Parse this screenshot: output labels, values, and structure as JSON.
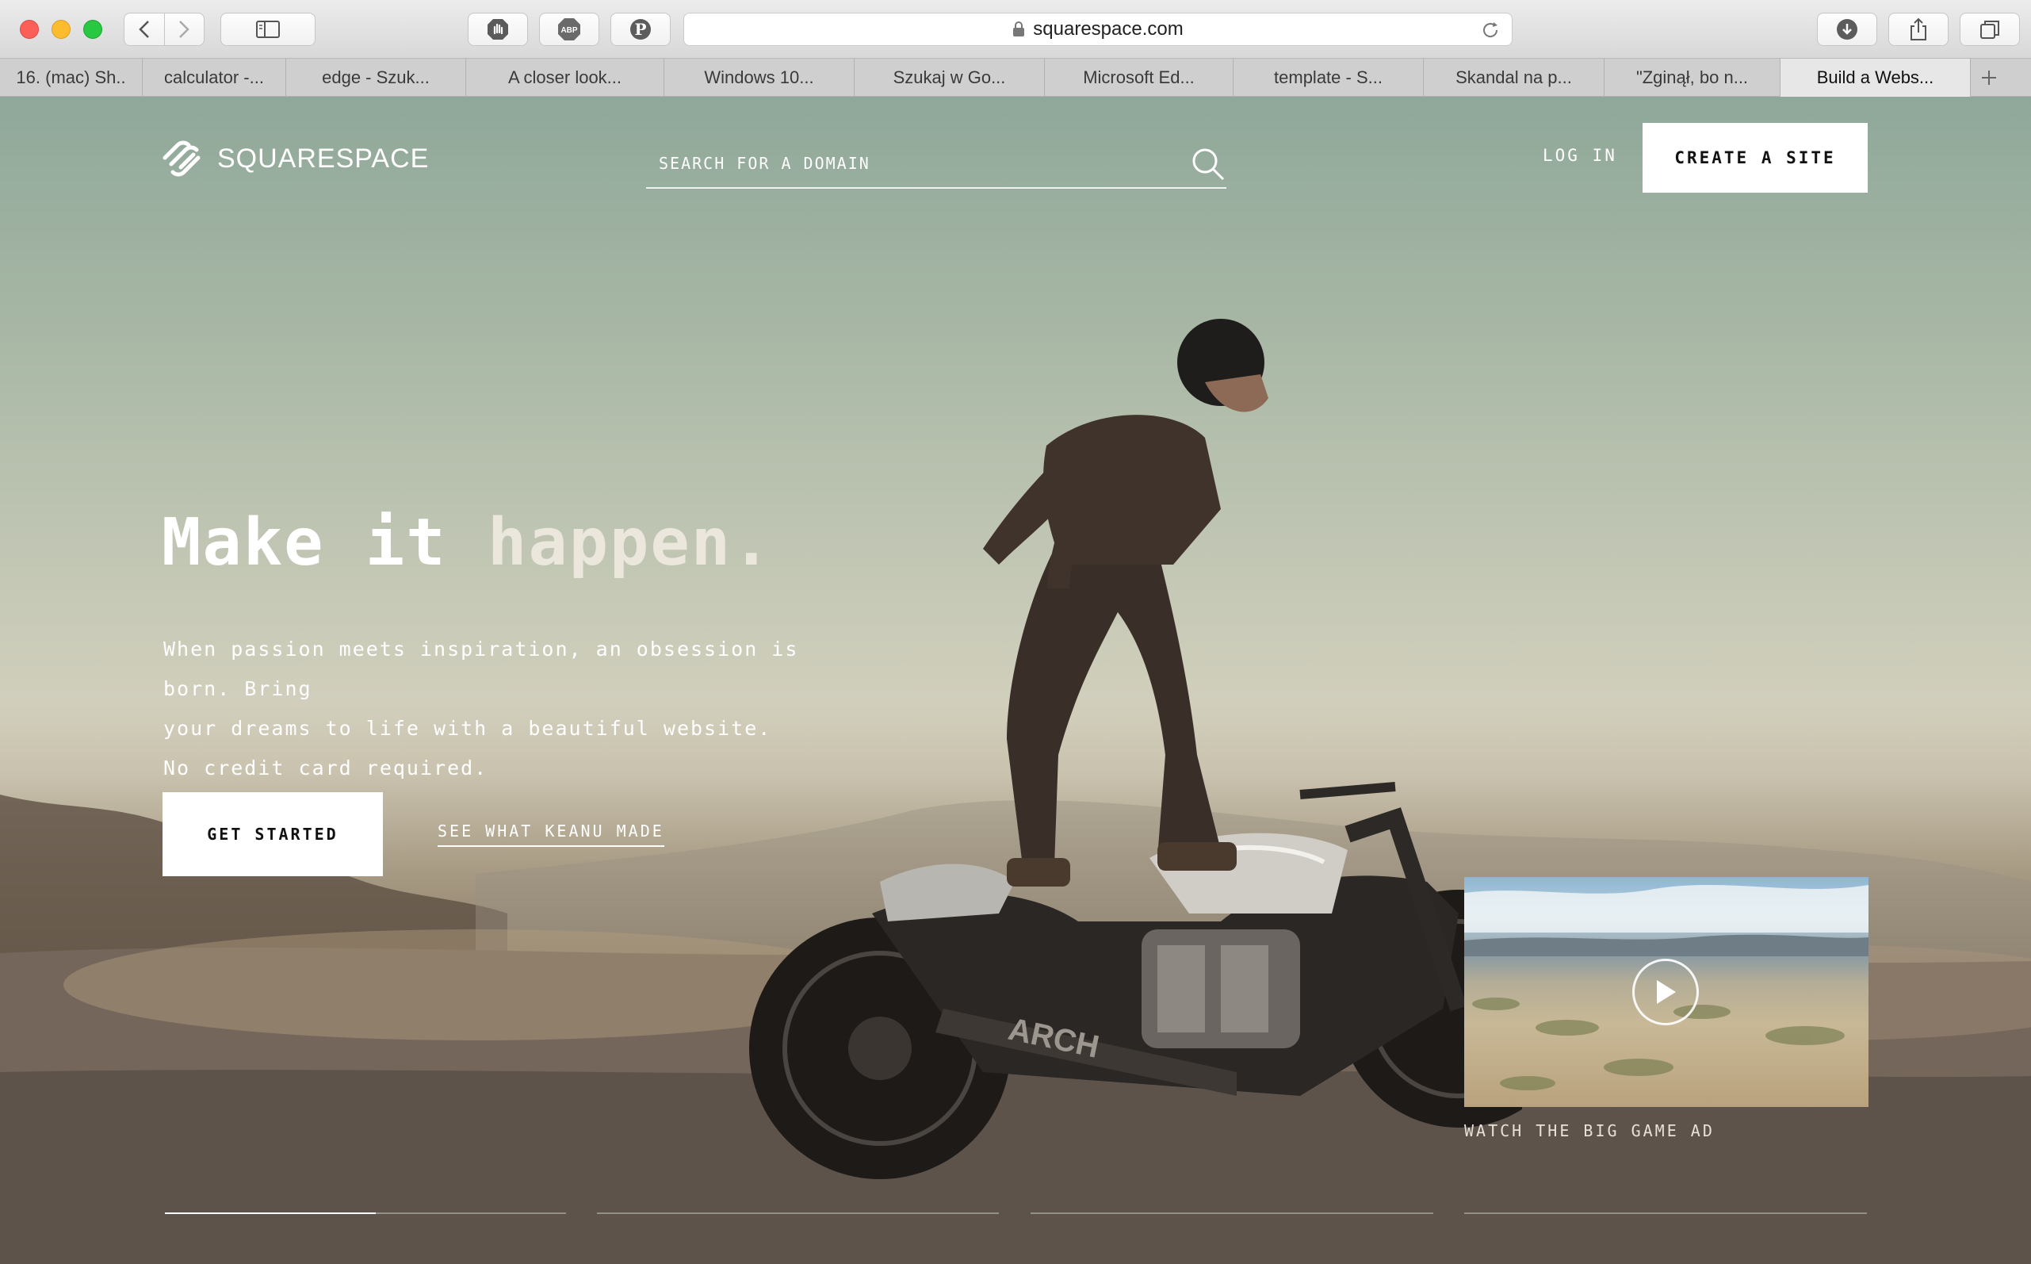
{
  "browser": {
    "url": "squarespace.com",
    "adblock_badge": "1",
    "tabs": [
      {
        "label": "16. (mac) Sh..",
        "active": false
      },
      {
        "label": "calculator -...",
        "active": false
      },
      {
        "label": "edge - Szuk...",
        "active": false
      },
      {
        "label": "A closer look...",
        "active": false
      },
      {
        "label": "Windows 10...",
        "active": false
      },
      {
        "label": "Szukaj w Go...",
        "active": false
      },
      {
        "label": "Microsoft Ed...",
        "active": false
      },
      {
        "label": "template - S...",
        "active": false
      },
      {
        "label": "Skandal na p...",
        "active": false
      },
      {
        "label": "\"Zginął, bo n...",
        "active": false
      },
      {
        "label": "Build a Webs...",
        "active": true
      }
    ]
  },
  "site": {
    "logo_text": "SQUARESPACE",
    "search_placeholder": "SEARCH FOR A DOMAIN",
    "login_label": "LOG IN",
    "create_label": "CREATE A SITE",
    "headline_main": "Make it ",
    "headline_accent": "happen.",
    "subtext_line1": "When passion meets inspiration, an obsession is born. Bring",
    "subtext_line2": "your dreams to life with a beautiful website.",
    "subtext_line3": "No credit card required.",
    "get_started_label": "GET STARTED",
    "keanu_label": "SEE WHAT KEANU MADE",
    "video_caption": "WATCH THE BIG GAME AD",
    "bike_brand": "ARCH"
  },
  "colors": {
    "traffic_close": "#fc5f57",
    "traffic_min": "#fdbc2e",
    "traffic_max": "#28c840",
    "badge": "#e53935"
  }
}
